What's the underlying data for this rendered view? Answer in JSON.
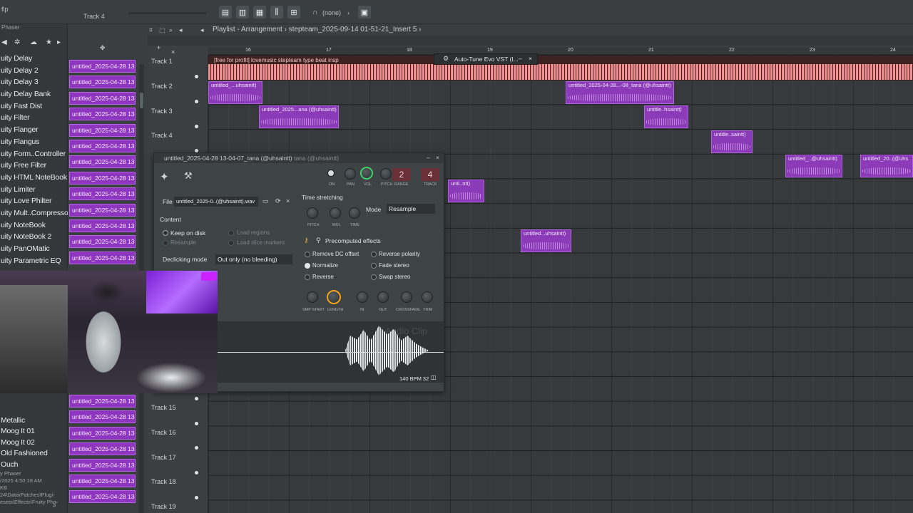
{
  "topbar": {
    "app_label": "flp",
    "track_label": "Track 4",
    "pattern_select": "(none)"
  },
  "browser": {
    "header": "Phaser",
    "plugins": [
      "uity Delay",
      "uity Delay 2",
      "uity Delay 3",
      "uity Delay Bank",
      "uity Fast Dist",
      "uity Filter",
      "uity Flanger",
      "uity Flangus",
      "uity Form..Controller",
      "uity Free Filter",
      "uity HTML NoteBook",
      "uity Limiter",
      "uity Love Philter",
      "uity Mult..Compressor",
      "uity NoteBook",
      "uity NoteBook 2",
      "uity PanOMatic",
      "uity Parametric EQ"
    ],
    "plugins_bottom": [
      "Metallic",
      "Moog It 01",
      "Moog It 02",
      "Old Fashioned",
      "Ouch"
    ],
    "info": [
      "y Phaser",
      "/2025 4:50:18 AM",
      "KB",
      "24\\Data\\Patches\\Plugi-",
      "esets\\Effects\\Fruity Pha-"
    ]
  },
  "channels": {
    "clips": [
      "untitled_2025-04-28 13-",
      "untitled_2025-04-28 13-",
      "untitled_2025-04-28 13-",
      "untitled_2025-04-28 13-",
      "untitled_2025-04-28 13-",
      "untitled_2025-04-28 13-",
      "untitled_2025-04-28 13-",
      "untitled_2025-04-28 13-",
      "untitled_2025-04-28 13-",
      "untitled_2025-04-28 13-",
      "untitled_2025-04-28 13-",
      "untitled_2025-04-28 13-",
      "untitled_2025-04-28 13-"
    ],
    "clips_bottom": [
      "untitled_2025-04-28 13-",
      "untitled_2025-04-28 13-",
      "untitled_2025-04-28 13-",
      "untitled_2025-04-28 13-",
      "untitled_2025-04-28 13-",
      "untitled_2025-04-28 13-",
      "untitled_2025-04-28 13-"
    ]
  },
  "playlist": {
    "title": "Playlist - Arrangement",
    "project": "stepteam_2025-09-14 01-51-21_Insert 5",
    "ruler": [
      "16",
      "17",
      "18",
      "19",
      "20",
      "21",
      "22",
      "23",
      "24"
    ],
    "tracks_top": [
      "Track 1",
      "Track 2",
      "Track 3",
      "Track 4"
    ],
    "tracks_bottom": [
      "Track 15",
      "Track 16",
      "Track 17",
      "Track 18",
      "Track 19"
    ],
    "big_clip_label": "[free for profit] lovemusic stepteam type beat insp",
    "clip_labels": {
      "t2a": "untitled_...uhsaintt)",
      "t2b": "untitled_2025-04-28...-08_tana (@uhsaintt)",
      "t3a": "untitled_2025...ana (@uhsaintt)",
      "t3b": "untitle..hsaintt)",
      "t4a": "untitle..saintt)",
      "t5a": "untitled_..@uhsaintt)",
      "t5b": "untitled_20..(@uhs",
      "t6a": "unti..ntt)",
      "t8a": "untitled...uhsaintt)"
    },
    "autotune": "Auto-Tune Evo VST (I..."
  },
  "channel_settings": {
    "title": "untitled_2025-04-28 13-04-07_tana (@uhsaintt)",
    "title_dim": "tana (@uhsaintt)",
    "knobs_top": [
      "ON",
      "PAN",
      "VOL",
      "PITCH",
      "RANGE",
      "TRACK"
    ],
    "range_value": "2",
    "track_value": "4",
    "file_label": "File",
    "file_value": "untitled_2025-0..(@uhsaintt).wav",
    "content_label": "Content",
    "keep_on_disk": "Keep on disk",
    "resample": "Resample",
    "load_regions": "Load regions",
    "load_slice_markers": "Load slice markers",
    "declicking_label": "Declicking mode",
    "declicking_value": "Out only (no bleeding)",
    "time_stretching": "Time stretching",
    "ts_knobs": [
      "PITCH",
      "MUL",
      "TIME"
    ],
    "mode_label": "Mode",
    "mode_value": "Resample",
    "precomputed": "Precomputed effects",
    "effects_left": [
      "Remove DC offset",
      "Normalize",
      "Reverse"
    ],
    "effects_right": [
      "Reverse polarity",
      "Fade stereo",
      "Swap stereo"
    ],
    "bottom_knobs": [
      "SMP START",
      "LENGTH",
      "IN",
      "OUT",
      "CROSSFADE",
      "TRIM"
    ],
    "watermark": "Audio Clip",
    "bpm_info": "140 BPM 32"
  },
  "colors": {
    "clip_purple": "#8c3bb8",
    "clip_salmon": "#f08a8a",
    "accent_green": "#3ecf6a",
    "accent_orange": "#f0a21a"
  }
}
